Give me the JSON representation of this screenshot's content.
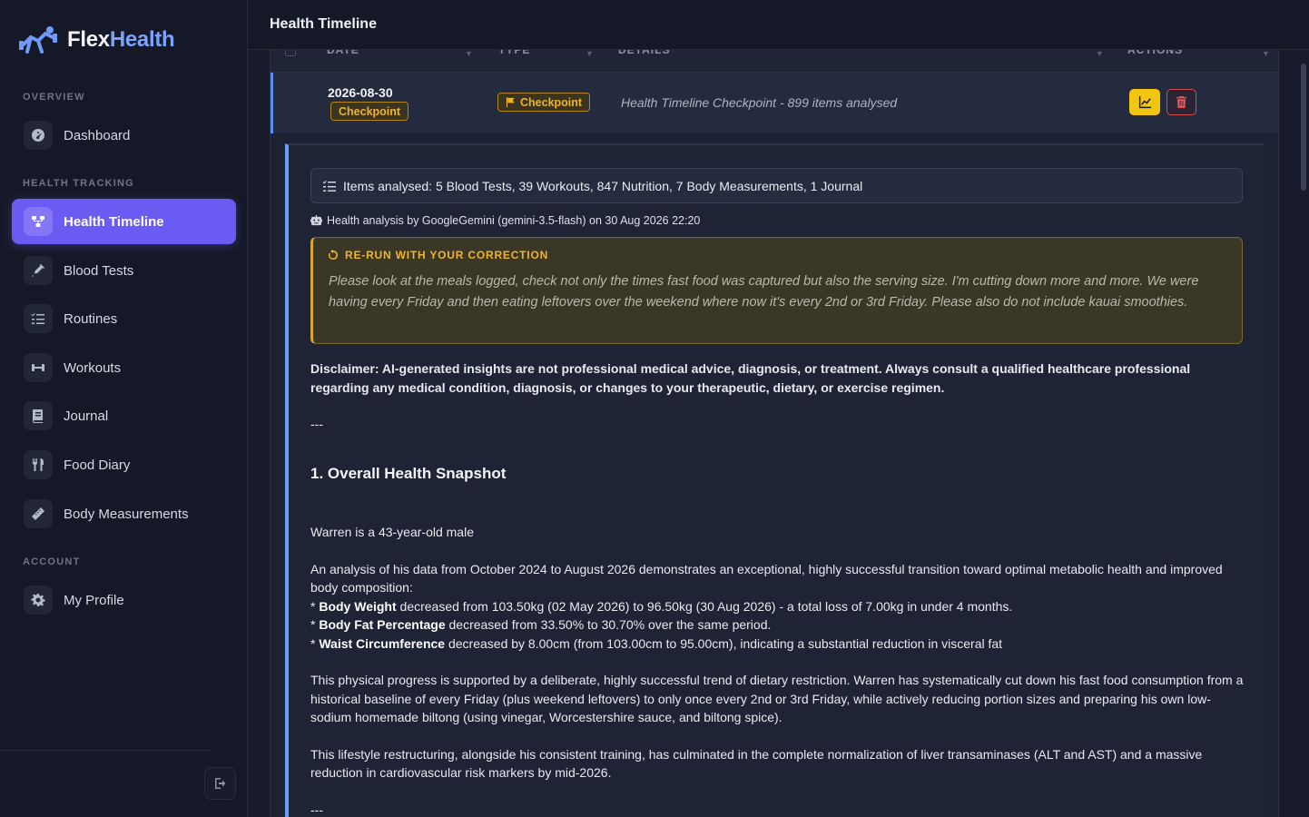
{
  "brand": {
    "part1": "Flex",
    "part2": "Health"
  },
  "sidebar": {
    "sections": {
      "overview": "OVERVIEW",
      "health_tracking": "HEALTH TRACKING",
      "account": "ACCOUNT"
    },
    "items": [
      {
        "label": "Dashboard",
        "icon": "dashboard-icon"
      },
      {
        "label": "Health Timeline",
        "icon": "timeline-icon",
        "active": true
      },
      {
        "label": "Blood Tests",
        "icon": "syringe-icon"
      },
      {
        "label": "Routines",
        "icon": "list-check-icon"
      },
      {
        "label": "Workouts",
        "icon": "dumbbell-icon"
      },
      {
        "label": "Journal",
        "icon": "book-icon"
      },
      {
        "label": "Food Diary",
        "icon": "utensils-icon"
      },
      {
        "label": "Body Measurements",
        "icon": "ruler-icon"
      },
      {
        "label": "My Profile",
        "icon": "gear-icon"
      }
    ]
  },
  "header": {
    "title": "Health Timeline"
  },
  "table": {
    "columns": [
      "DATE",
      "TYPE",
      "DETAILS",
      "ACTIONS"
    ],
    "row": {
      "date": "2026-08-30",
      "date_badge": "Checkpoint",
      "type_badge": "Checkpoint",
      "details": "Health Timeline Checkpoint - 899 items analysed"
    }
  },
  "expanded": {
    "items_analysed": "Items analysed: 5 Blood Tests, 39 Workouts, 847 Nutrition, 7 Body Measurements, 1 Journal",
    "analysis_meta": "Health analysis by GoogleGemini (gemini-3.5-flash) on 30 Aug 2026 22:20",
    "correction": {
      "title": "RE-RUN WITH YOUR CORRECTION",
      "text": "Please look at the meals logged, check not only the times fast food was captured but also the serving size. I'm cutting down more and more. We were having every Friday and then eating leftovers over the weekend where now it's every 2nd or 3rd Friday. Please also do not include kauai smoothies."
    },
    "report": {
      "disclaimer": "Disclaimer: AI-generated insights are not professional medical advice, diagnosis, or treatment. Always consult a qualified healthcare professional regarding any medical condition, diagnosis, or changes to your therapeutic, dietary, or exercise regimen.",
      "separator": "---",
      "heading1": "1. Overall Health Snapshot",
      "intro": "Warren is a 43-year-old male",
      "analysis_line1": "An analysis of his data from October 2024 to August 2026 demonstrates an exceptional, highly successful transition toward optimal metabolic health and improved body composition:",
      "bullets": [
        {
          "prefix": "* ",
          "bold": "Body Weight",
          "text": " decreased from 103.50kg (02 May 2026) to 96.50kg (30 Aug 2026) - a total loss of 7.00kg in under 4 months."
        },
        {
          "prefix": "* ",
          "bold": "Body Fat Percentage",
          "text": " decreased from 33.50% to 30.70% over the same period."
        },
        {
          "prefix": "* ",
          "bold": "Waist Circumference",
          "text": " decreased by 8.00cm (from 103.00cm to 95.00cm), indicating a substantial reduction in visceral fat"
        }
      ],
      "para2": "This physical progress is supported by a deliberate, highly successful trend of dietary restriction. Warren has systematically cut down his fast food consumption from a historical baseline of every Friday (plus weekend leftovers) to only once every 2nd or 3rd Friday, while actively reducing portion sizes and preparing his own low-sodium homemade biltong (using vinegar, Worcestershire sauce, and biltong spice).",
      "para3": "This lifestyle restructuring, alongside his consistent training, has culminated in the complete normalization of liver transaminases (ALT and AST) and a massive reduction in cardiovascular risk markers by mid-2026.",
      "separator2": "---"
    }
  },
  "colors": {
    "accent": "#6a5cf2",
    "checkpoint": "#f0b429",
    "danger": "#e05454",
    "row_marker": "#5b8def"
  }
}
